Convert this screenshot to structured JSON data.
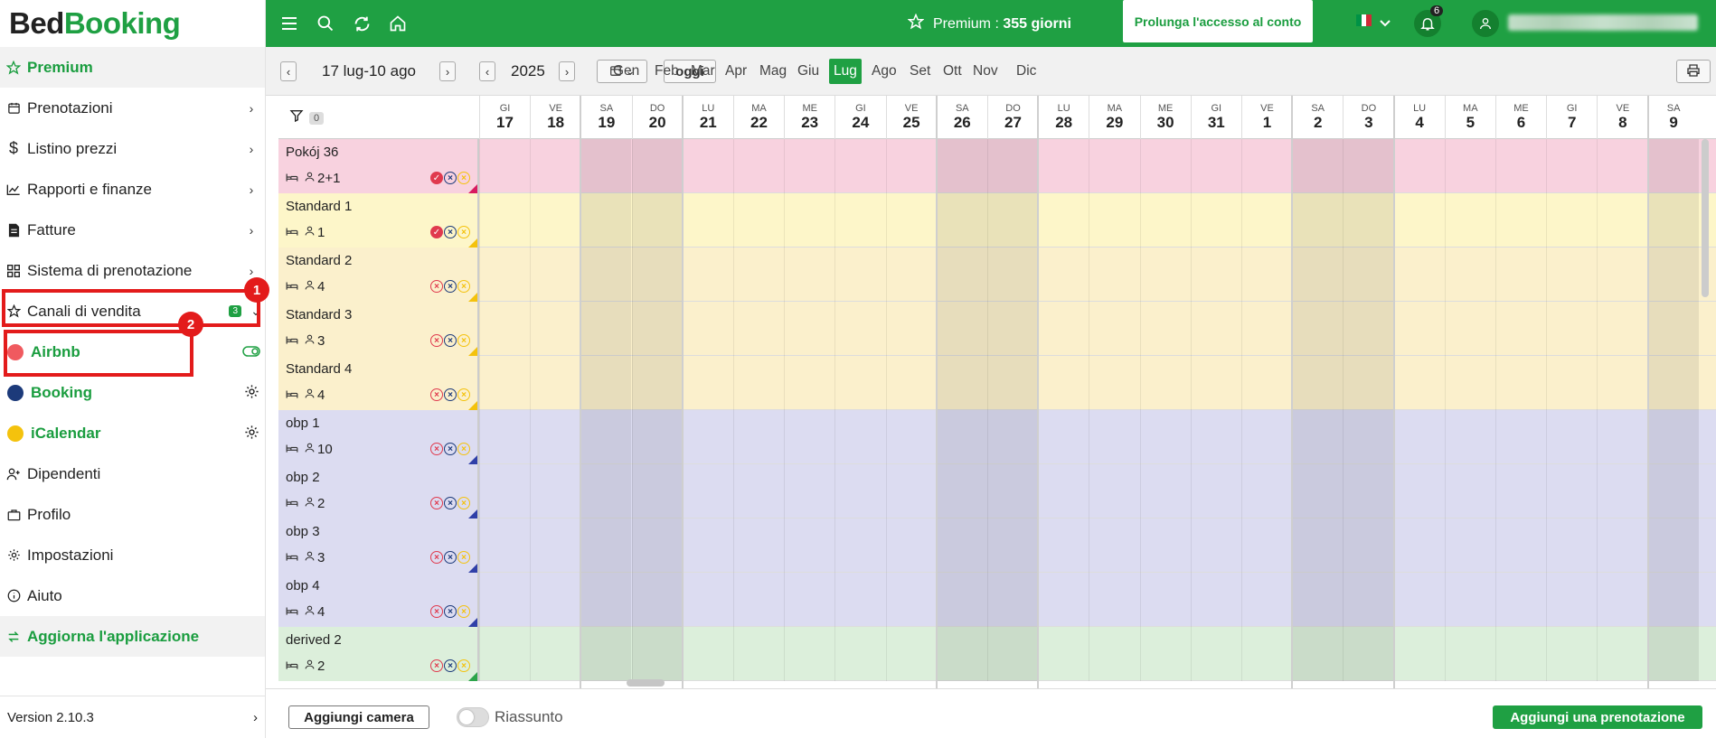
{
  "brand": {
    "part1": "Bed",
    "part2": "Booking"
  },
  "sidebar": {
    "premium": "Premium",
    "items": [
      {
        "label": "Prenotazioni"
      },
      {
        "label": "Listino prezzi"
      },
      {
        "label": "Rapporti e finanze"
      },
      {
        "label": "Fatture"
      },
      {
        "label": "Sistema di prenotazione"
      }
    ],
    "channels": {
      "label": "Canali di vendita",
      "badge": "3"
    },
    "sub": [
      {
        "label": "Airbnb",
        "color": "#f05a5f"
      },
      {
        "label": "Booking",
        "color": "#1c3a7a"
      },
      {
        "label": "iCalendar",
        "color": "#f4c20d"
      }
    ],
    "items2": [
      {
        "label": "Dipendenti"
      },
      {
        "label": "Profilo"
      },
      {
        "label": "Impostazioni"
      },
      {
        "label": "Aiuto"
      }
    ],
    "update": "Aggiorna l'applicazione",
    "version": "Version 2.10.3",
    "markers": [
      "1",
      "2"
    ]
  },
  "topbar": {
    "premium_label": "Premium : ",
    "premium_value": "355 giorni",
    "extend": "Prolunga l'accesso al conto",
    "notifications": "6"
  },
  "toolbar": {
    "range": "17 lug-10 ago",
    "year": "2025",
    "today": "oggi",
    "months": [
      "Gen",
      "Feb",
      "Mar",
      "Apr",
      "Mag",
      "Giu",
      "Lug",
      "Ago",
      "Set",
      "Ott",
      "Nov",
      "Dic"
    ],
    "active_month": "Lug"
  },
  "grid": {
    "filter_count": "0",
    "days": [
      [
        "GI",
        "17"
      ],
      [
        "VE",
        "18"
      ],
      [
        "SA",
        "19"
      ],
      [
        "DO",
        "20"
      ],
      [
        "LU",
        "21"
      ],
      [
        "MA",
        "22"
      ],
      [
        "ME",
        "23"
      ],
      [
        "GI",
        "24"
      ],
      [
        "VE",
        "25"
      ],
      [
        "SA",
        "26"
      ],
      [
        "DO",
        "27"
      ],
      [
        "LU",
        "28"
      ],
      [
        "MA",
        "29"
      ],
      [
        "ME",
        "30"
      ],
      [
        "GI",
        "31"
      ],
      [
        "VE",
        "1"
      ],
      [
        "SA",
        "2"
      ],
      [
        "DO",
        "3"
      ],
      [
        "LU",
        "4"
      ],
      [
        "MA",
        "5"
      ],
      [
        "ME",
        "6"
      ],
      [
        "GI",
        "7"
      ],
      [
        "VE",
        "8"
      ],
      [
        "SA",
        "9"
      ]
    ],
    "rooms": [
      {
        "name": "Pokój 36",
        "guests": "2+1",
        "bg": "#f8d2df",
        "accent": "#d81b60",
        "first": "ok"
      },
      {
        "name": "Standard 1",
        "guests": "1",
        "bg": "#fdf6c9",
        "accent": "#f4c20d",
        "first": "ok"
      },
      {
        "name": "Standard 2",
        "guests": "4",
        "bg": "#fbf0cc",
        "accent": "#f4c20d",
        "first": "x"
      },
      {
        "name": "Standard 3",
        "guests": "3",
        "bg": "#fbf0cc",
        "accent": "#f4c20d",
        "first": "x"
      },
      {
        "name": "Standard 4",
        "guests": "4",
        "bg": "#fbf0cc",
        "accent": "#f4c20d",
        "first": "x"
      },
      {
        "name": "obp 1",
        "guests": "10",
        "bg": "#dcdcf1",
        "accent": "#2f3fa8",
        "first": "x"
      },
      {
        "name": "obp 2",
        "guests": "2",
        "bg": "#dcdcf1",
        "accent": "#2f3fa8",
        "first": "x"
      },
      {
        "name": "obp 3",
        "guests": "3",
        "bg": "#dcdcf1",
        "accent": "#2f3fa8",
        "first": "x"
      },
      {
        "name": "obp 4",
        "guests": "4",
        "bg": "#dcdcf1",
        "accent": "#2f3fa8",
        "first": "x"
      },
      {
        "name": "derived 2",
        "guests": "2",
        "bg": "#dcefdb",
        "accent": "#2ca44a",
        "first": "x"
      }
    ]
  },
  "bottom": {
    "add_room": "Aggiungi camera",
    "summary": "Riassunto",
    "add_booking": "Aggiungi una prenotazione"
  }
}
